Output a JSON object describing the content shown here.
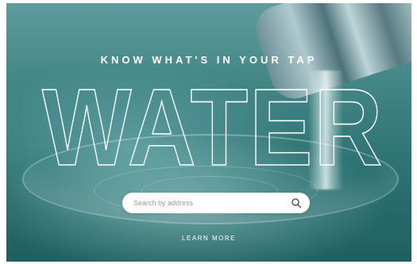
{
  "hero": {
    "tagline": "KNOW WHAT'S IN YOUR TAP",
    "headline": "WATER"
  },
  "search": {
    "placeholder": "Search by address",
    "icon": "search-icon"
  },
  "learn_more_link": "LEARN MORE",
  "colors": {
    "background_dark": "#1f5f60",
    "background_light": "#5f9c9c",
    "text": "#ffffff",
    "search_bg": "#ffffff"
  }
}
